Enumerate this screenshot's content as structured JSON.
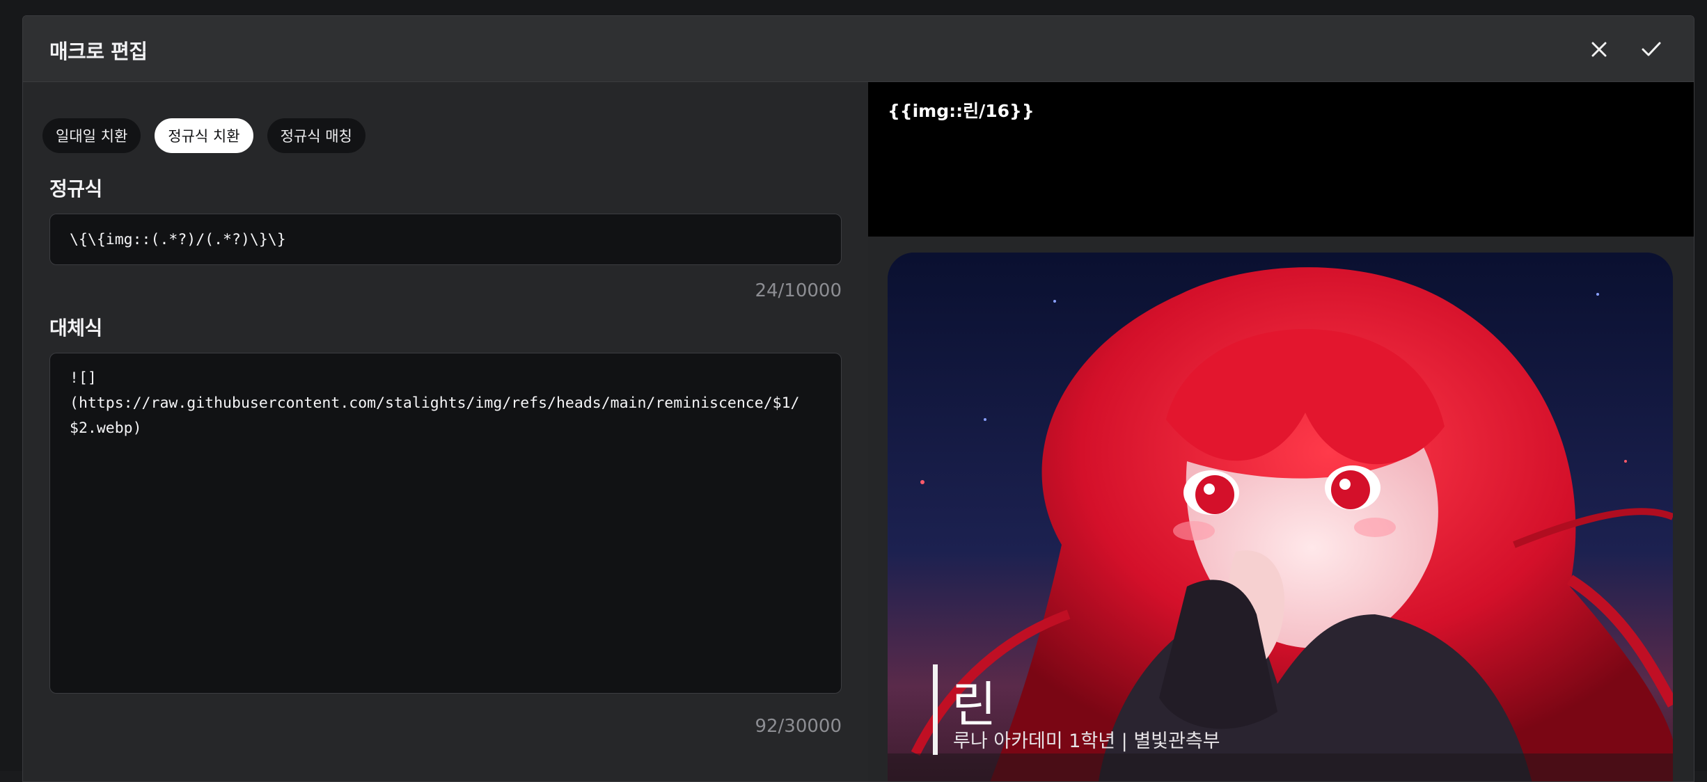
{
  "modal": {
    "title": "매크로 편집",
    "close_icon": "close-icon",
    "confirm_icon": "check-icon"
  },
  "mode_chips": [
    {
      "label": "일대일 치환",
      "active": false
    },
    {
      "label": "정규식 치환",
      "active": true
    },
    {
      "label": "정규식 매칭",
      "active": false
    }
  ],
  "regex": {
    "label": "정규식",
    "value": "\\{\\{img::(.*?)/(.*?)\\}\\}",
    "counter": "24/10000"
  },
  "replacement": {
    "label": "대체식",
    "value": "![]\n(https://raw.githubusercontent.com/stalights/img/refs/heads/main/reminiscence/$1/$2.webp)",
    "counter": "92/30000"
  },
  "preview": {
    "input_text": "{{img::린/16}}",
    "image_caption_name": "린",
    "image_caption_sub": "루나 아카데미 1학년 | 별빛관측부"
  },
  "colors": {
    "chip_active_bg": "#ffffff",
    "chip_bg": "#121315",
    "hair_red": "#e0142a"
  }
}
